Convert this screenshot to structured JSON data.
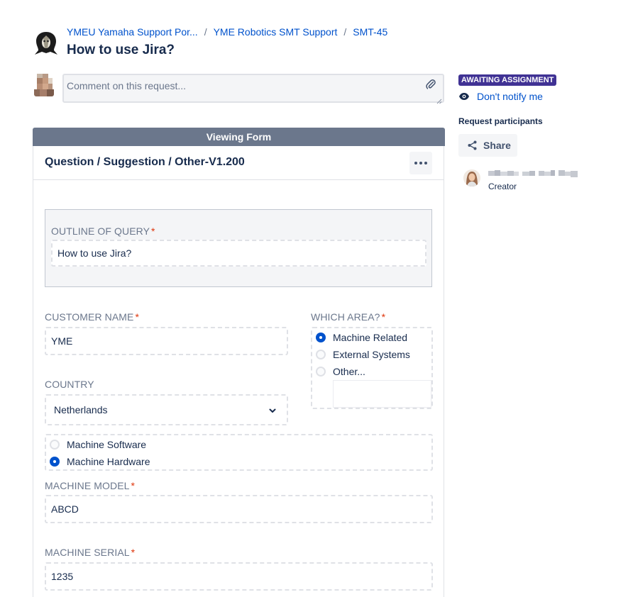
{
  "breadcrumbs": {
    "items": [
      "YMEU Yamaha Support Por...",
      "YME Robotics SMT Support",
      "SMT-45"
    ],
    "separator": "/"
  },
  "title": "How to use Jira?",
  "comment": {
    "placeholder": "Comment on this request..."
  },
  "form": {
    "banner": "Viewing Form",
    "title": "Question / Suggestion / Other-V1.200",
    "outline": {
      "label": "OUTLINE OF QUERY",
      "value": "How to use Jira?"
    },
    "customer_name": {
      "label": "CUSTOMER NAME",
      "value": "YME"
    },
    "which_area": {
      "label": "WHICH AREA?",
      "options": [
        {
          "label": "Machine Related",
          "selected": true
        },
        {
          "label": "External Systems",
          "selected": false
        },
        {
          "label": "Other...",
          "selected": false
        }
      ]
    },
    "country": {
      "label": "COUNTRY",
      "value": "Netherlands"
    },
    "machine_type": {
      "options": [
        {
          "label": "Machine Software",
          "selected": false
        },
        {
          "label": "Machine Hardware",
          "selected": true
        }
      ]
    },
    "machine_model": {
      "label": "MACHINE MODEL",
      "value": "ABCD"
    },
    "machine_serial": {
      "label": "MACHINE SERIAL",
      "value": "1235"
    },
    "required_marker": "*"
  },
  "sidebar": {
    "status": "AWAITING ASSIGNMENT",
    "notify_label": "Don't notify me",
    "participants_heading": "Request participants",
    "share_label": "Share",
    "participant": {
      "role": "Creator"
    }
  },
  "colors": {
    "link": "#0052cc",
    "status_badge": "#403294",
    "banner": "#6b778c",
    "required": "#de350b",
    "radio_selected": "#0052cc"
  },
  "icons": [
    "project-logo-icon",
    "paperclip-icon",
    "resize-grip-icon",
    "more-icon",
    "chevron-down-icon",
    "eye-icon",
    "share-icon"
  ]
}
